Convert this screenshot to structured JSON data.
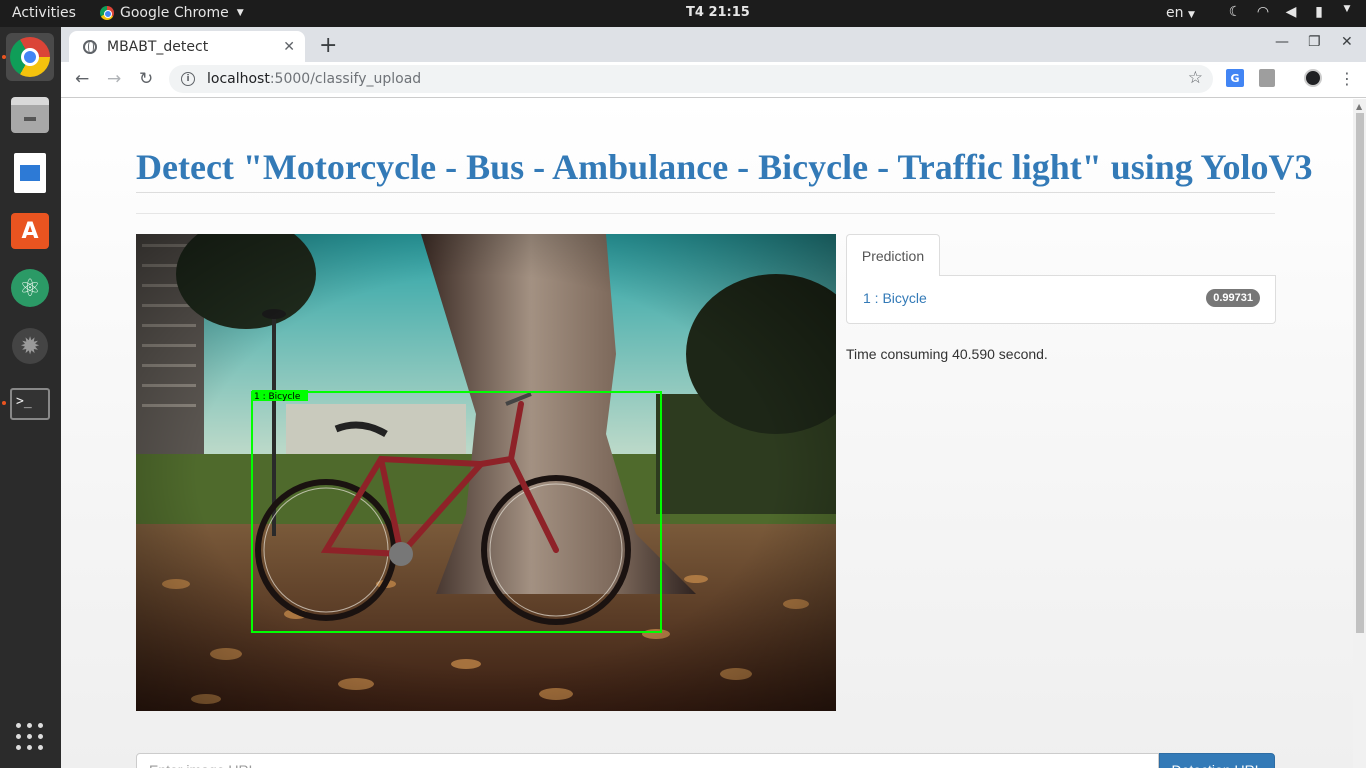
{
  "topbar": {
    "activities": "Activities",
    "app_name": "Google Chrome",
    "clock": "T4 21:15",
    "language": "en"
  },
  "browser": {
    "tab_title": "MBABT_detect",
    "url_host": "localhost",
    "url_path": ":5000/classify_upload"
  },
  "page": {
    "title": "Detect \"Motorcycle - Bus - Ambulance - Bicycle - Traffic light\" using YoloV3",
    "detection_label": "1 : Bicycle",
    "detection_box_color": "#00ff00",
    "prediction_tab": "Prediction",
    "predictions": [
      {
        "label": "1 : Bicycle",
        "score": "0.99731"
      }
    ],
    "time_text": "Time consuming 40.590 second.",
    "url_input_placeholder": "Enter image URL",
    "url_button": "Detection URL"
  },
  "colors": {
    "link_blue": "#337ab7",
    "badge_gray": "#777777",
    "ubuntu_orange": "#e95420"
  }
}
